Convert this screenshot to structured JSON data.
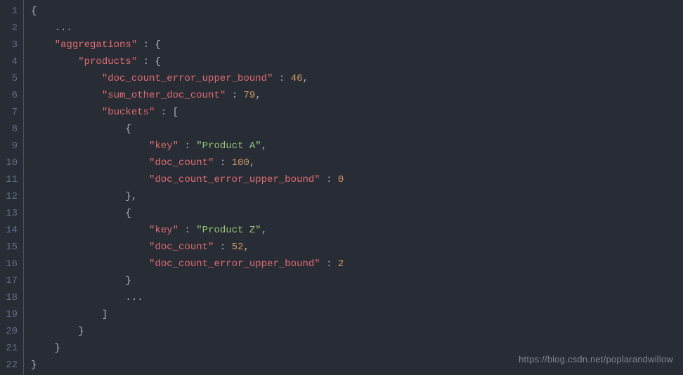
{
  "lineCount": 22,
  "watermark": "https://blog.csdn.net/poplarandwillow",
  "lines": {
    "l1": [
      [
        "p",
        "{"
      ]
    ],
    "l2": [
      [
        "p",
        "    ..."
      ]
    ],
    "l3": [
      [
        "p",
        "    "
      ],
      [
        "k",
        "\"aggregations\""
      ],
      [
        "p",
        " : {"
      ]
    ],
    "l4": [
      [
        "p",
        "        "
      ],
      [
        "k",
        "\"products\""
      ],
      [
        "p",
        " : {"
      ]
    ],
    "l5": [
      [
        "p",
        "            "
      ],
      [
        "k",
        "\"doc_count_error_upper_bound\""
      ],
      [
        "p",
        " : "
      ],
      [
        "n",
        "46"
      ],
      [
        "p",
        ","
      ]
    ],
    "l6": [
      [
        "p",
        "            "
      ],
      [
        "k",
        "\"sum_other_doc_count\""
      ],
      [
        "p",
        " : "
      ],
      [
        "n",
        "79"
      ],
      [
        "p",
        ","
      ]
    ],
    "l7": [
      [
        "p",
        "            "
      ],
      [
        "k",
        "\"buckets\""
      ],
      [
        "p",
        " : ["
      ]
    ],
    "l8": [
      [
        "p",
        "                {"
      ]
    ],
    "l9": [
      [
        "p",
        "                    "
      ],
      [
        "k",
        "\"key\""
      ],
      [
        "p",
        " : "
      ],
      [
        "s",
        "\"Product A\""
      ],
      [
        "p",
        ","
      ]
    ],
    "l10": [
      [
        "p",
        "                    "
      ],
      [
        "k",
        "\"doc_count\""
      ],
      [
        "p",
        " : "
      ],
      [
        "n",
        "100"
      ],
      [
        "p",
        ","
      ]
    ],
    "l11": [
      [
        "p",
        "                    "
      ],
      [
        "k",
        "\"doc_count_error_upper_bound\""
      ],
      [
        "p",
        " : "
      ],
      [
        "n",
        "0"
      ]
    ],
    "l12": [
      [
        "p",
        "                },"
      ]
    ],
    "l13": [
      [
        "p",
        "                {"
      ]
    ],
    "l14": [
      [
        "p",
        "                    "
      ],
      [
        "k",
        "\"key\""
      ],
      [
        "p",
        " : "
      ],
      [
        "s",
        "\"Product Z\""
      ],
      [
        "p",
        ","
      ]
    ],
    "l15": [
      [
        "p",
        "                    "
      ],
      [
        "k",
        "\"doc_count\""
      ],
      [
        "p",
        " : "
      ],
      [
        "n",
        "52"
      ],
      [
        "p",
        ","
      ]
    ],
    "l16": [
      [
        "p",
        "                    "
      ],
      [
        "k",
        "\"doc_count_error_upper_bound\""
      ],
      [
        "p",
        " : "
      ],
      [
        "n",
        "2"
      ]
    ],
    "l17": [
      [
        "p",
        "                }"
      ]
    ],
    "l18": [
      [
        "p",
        "                ..."
      ]
    ],
    "l19": [
      [
        "p",
        "            ]"
      ]
    ],
    "l20": [
      [
        "p",
        "        }"
      ]
    ],
    "l21": [
      [
        "p",
        "    }"
      ]
    ],
    "l22": [
      [
        "p",
        "}"
      ]
    ]
  }
}
